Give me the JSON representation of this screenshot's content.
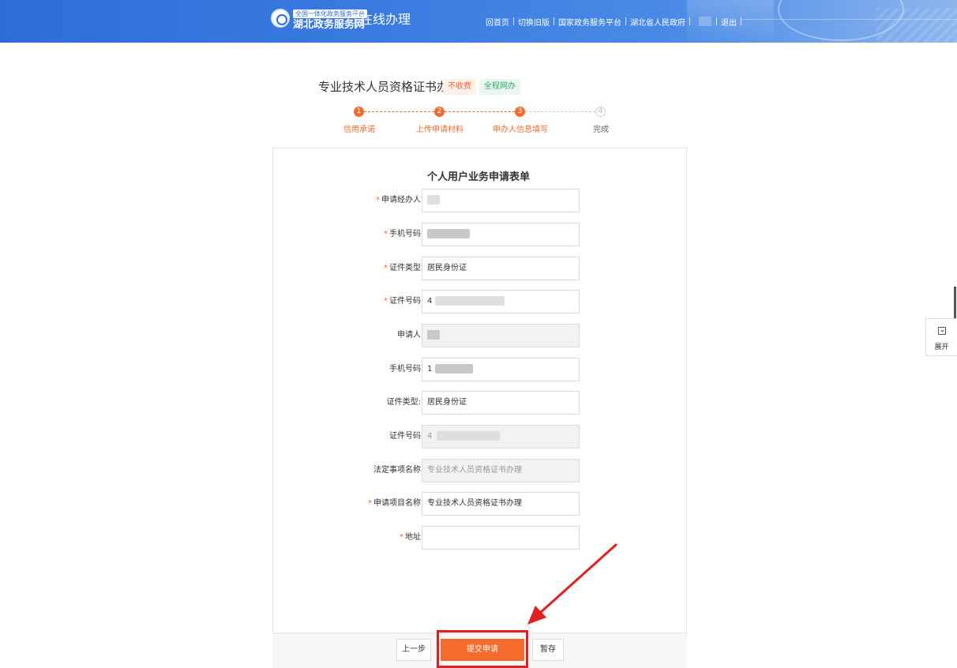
{
  "header": {
    "logo_top": "全国一体化政务服务平台",
    "logo_main": "湖北政务服务网",
    "logo_sub": "在线办理",
    "nav": [
      "回首页",
      "切换旧版",
      "国家政务服务平台",
      "湖北省人民政府",
      "退出"
    ]
  },
  "page": {
    "title": "专业技术人员资格证书办理",
    "tag_fee": "不收费",
    "tag_online": "全程网办"
  },
  "steps": [
    {
      "num": "1",
      "label": "信用承诺",
      "state": "done"
    },
    {
      "num": "2",
      "label": "上传申请材料",
      "state": "done"
    },
    {
      "num": "3",
      "label": "申办人信息填写",
      "state": "current"
    },
    {
      "num": "4",
      "label": "完成",
      "state": "todo"
    }
  ],
  "form": {
    "title": "个人用户业务申请表单",
    "fields": [
      {
        "label": "申请经办人",
        "required": true,
        "value": ""
      },
      {
        "label": "手机号码",
        "required": true,
        "value": ""
      },
      {
        "label": "证件类型",
        "required": true,
        "value": "居民身份证"
      },
      {
        "label": "证件号码",
        "required": true,
        "value": "4"
      },
      {
        "label": "申请人",
        "required": false,
        "value": ""
      },
      {
        "label": "手机号码",
        "required": false,
        "value": "1"
      },
      {
        "label": "证件类型:",
        "required": false,
        "value": "居民身份证"
      },
      {
        "label": "证件号码",
        "required": false,
        "value": "4"
      },
      {
        "label": "法定事项名称",
        "required": false,
        "value": "专业技术人员资格证书办理"
      },
      {
        "label": "申请项目名称",
        "required": true,
        "value": "专业技术人员资格证书办理"
      },
      {
        "label": "地址",
        "required": true,
        "value": ""
      }
    ],
    "required_mark": "*"
  },
  "buttons": {
    "prev": "上一步",
    "submit": "提交申请",
    "save": "暂存"
  },
  "side": {
    "expand": "展开"
  },
  "colors": {
    "accent": "#f36b2d",
    "header_blue": "#2e6dd8",
    "annotation_red": "#e02020"
  }
}
